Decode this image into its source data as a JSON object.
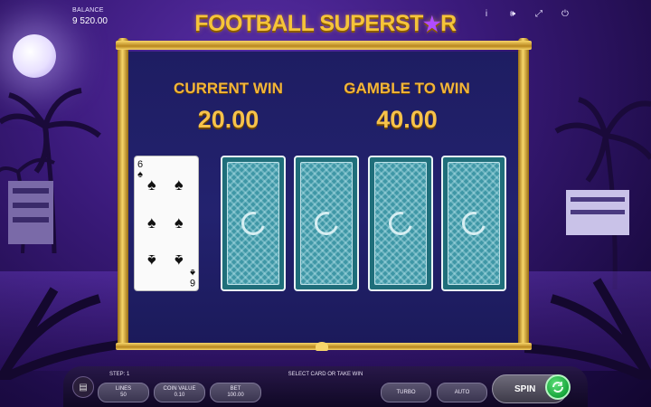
{
  "balance": {
    "label": "BALANCE",
    "value": "9 520.00"
  },
  "logo": {
    "text_main": "FOOTBALL SUPERST",
    "star": "★",
    "text_end": "R"
  },
  "top_icons": [
    {
      "name": "info",
      "glyph": "i"
    },
    {
      "name": "sound",
      "glyph": "🕪"
    },
    {
      "name": "fullscreen",
      "glyph": "⤢"
    },
    {
      "name": "power",
      "glyph": "⏻"
    }
  ],
  "gamble": {
    "current_win_label": "CURRENT WIN",
    "current_win_value": "20.00",
    "gamble_to_win_label": "GAMBLE TO WIN",
    "gamble_to_win_value": "40.00"
  },
  "dealer_card": {
    "rank": "6",
    "suit": "♠",
    "color": "#111111"
  },
  "cards": [
    {
      "state": "face-down"
    },
    {
      "state": "face-down"
    },
    {
      "state": "face-down"
    },
    {
      "state": "face-down"
    }
  ],
  "bottom": {
    "step": "STEP: 1",
    "message": "SELECT CARD OR TAKE WIN",
    "lines_label": "LINES",
    "lines_value": "50",
    "coin_label": "COIN VALUE",
    "coin_value": "0.10",
    "bet_label": "BET",
    "bet_value": "100.00",
    "turbo": "TURBO",
    "auto": "AUTO",
    "spin": "SPIN"
  },
  "colors": {
    "gold": "#f2b53a",
    "board": "#1e1d62",
    "card_back": "#3f97a6",
    "spin_green": "#16a53a"
  }
}
